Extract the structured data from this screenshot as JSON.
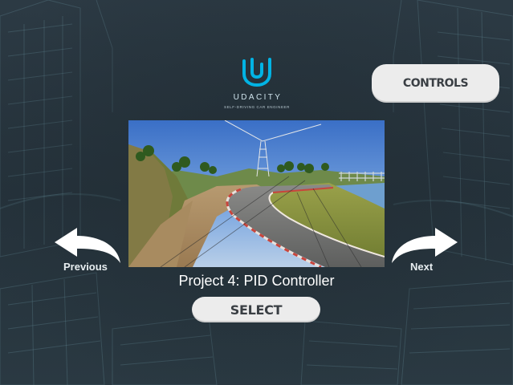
{
  "brand": {
    "name": "UDACITY",
    "tagline": "SELF-DRIVING CAR ENGINEER"
  },
  "header": {
    "controls_label": "CONTROLS"
  },
  "track": {
    "title": "Project 4: PID Controller"
  },
  "navigation": {
    "previous_label": "Previous",
    "next_label": "Next"
  },
  "actions": {
    "select_label": "SELECT"
  },
  "icons": {
    "logo": "udacity-logo-icon",
    "previous": "curved-arrow-left-icon",
    "next": "curved-arrow-right-icon"
  },
  "colors": {
    "logo_blue": "#02b3e4",
    "button_bg": "#ececec",
    "button_text": "#3a3f44",
    "background": "#27353f"
  }
}
